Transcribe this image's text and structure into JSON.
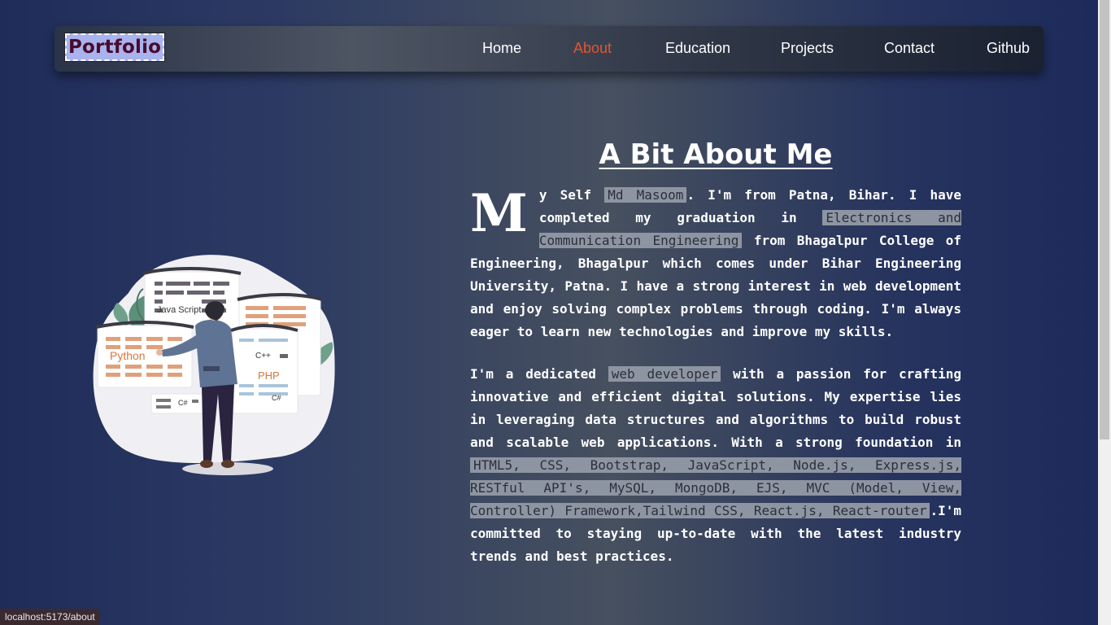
{
  "brand": "Portfolio",
  "nav": [
    {
      "label": "Home",
      "active": false
    },
    {
      "label": "About",
      "active": true
    },
    {
      "label": "Education",
      "active": false
    },
    {
      "label": "Projects",
      "active": false
    },
    {
      "label": "Contact",
      "active": false
    },
    {
      "label": "Github",
      "active": false
    }
  ],
  "about": {
    "title": "A Bit About Me",
    "p1": {
      "dropcap": "M",
      "t1": "y Self ",
      "h1": "Md Masoom",
      "t2": ". I'm from Patna, Bihar. I have completed my graduation in ",
      "h2": "Electronics and Communication Engineering",
      "t3": " from Bhagalpur College of Engineering, Bhagalpur which comes under Bihar Engineering University, Patna. I have a strong interest in web development and enjoy solving complex problems through coding. I'm always eager to learn new technologies and improve my skills."
    },
    "p2": {
      "t1": "I'm a dedicated ",
      "h1": "web developer",
      "t2": " with a passion for crafting innovative and efficient digital solutions. My expertise lies in leveraging data structures and algorithms to build robust and scalable web applications. With a strong foundation in ",
      "h2": "HTML5, CSS, Bootstrap, JavaScript, Node.js, Express.js, RESTful API's, MySQL, MongoDB, EJS, MVC (Model, View, Controller) Framework,Tailwind CSS, React.js, React-router",
      "t3": ".I'm committed to staying up-to-date with the latest industry trends and best practices."
    }
  },
  "illustration": {
    "labels": [
      "Java Script",
      "Python",
      "C++",
      "PHP",
      "C#",
      "C#"
    ]
  },
  "status_url": "localhost:5173/about",
  "colors": {
    "active_nav": "#e2562b",
    "brand_bg": "#a9b3ee",
    "brand_text": "#4a0a2e"
  }
}
